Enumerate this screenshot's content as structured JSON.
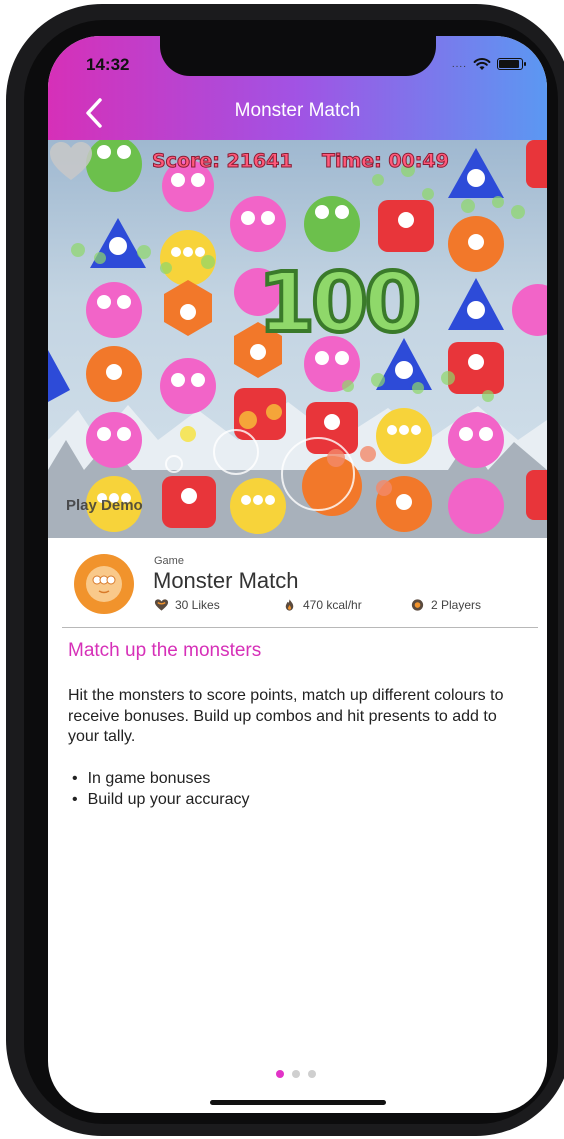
{
  "status_bar": {
    "time": "14:32",
    "signal": "....",
    "wifi_icon": "wifi-icon",
    "battery_icon": "battery-icon"
  },
  "nav": {
    "title": "Monster Match",
    "back_icon": "chevron-left-icon"
  },
  "game_preview": {
    "score_label": "Score: 21641",
    "time_label": "Time: 00:49",
    "combo_text": "100",
    "play_demo_label": "Play Demo",
    "like_icon": "heart-icon"
  },
  "game_info": {
    "category": "Game",
    "name": "Monster Match",
    "likes": "30 Likes",
    "calories": "470 kcal/hr",
    "players": "2 Players"
  },
  "description": {
    "heading": "Match up the monsters",
    "body": "Hit the monsters to score points, match up different colours to receive bonuses. Build up combos and hit presents to add to your tally.",
    "bullets": [
      "In game bonuses",
      "Build up your accuracy"
    ]
  },
  "pager": {
    "total": 3,
    "active": 1
  },
  "colors": {
    "accent": "#e233c7",
    "gradient_start": "#d630b8",
    "gradient_end": "#5b98f2",
    "logo_orange": "#f1932c"
  }
}
